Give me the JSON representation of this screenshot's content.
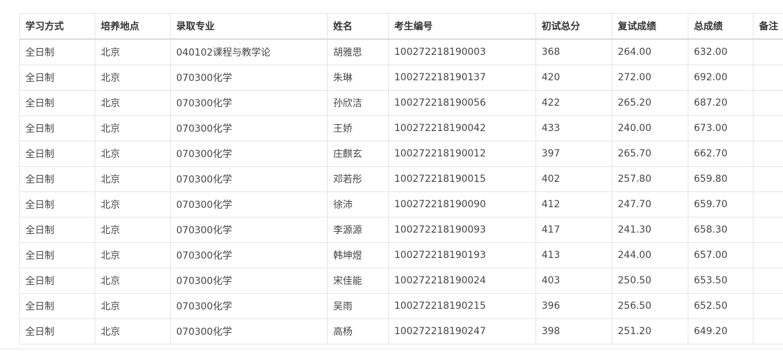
{
  "table": {
    "headers": [
      "学习方式",
      "培养地点",
      "录取专业",
      "姓名",
      "考生编号",
      "初试总分",
      "复试成绩",
      "总成绩",
      "备注"
    ],
    "rows": [
      [
        "全日制",
        "北京",
        "040102课程与教学论",
        "胡雅思",
        "100272218190003",
        "368",
        "264.00",
        "632.00",
        ""
      ],
      [
        "全日制",
        "北京",
        "070300化学",
        "朱琳",
        "100272218190137",
        "420",
        "272.00",
        "692.00",
        ""
      ],
      [
        "全日制",
        "北京",
        "070300化学",
        "孙欣洁",
        "100272218190056",
        "422",
        "265.20",
        "687.20",
        ""
      ],
      [
        "全日制",
        "北京",
        "070300化学",
        "王娇",
        "100272218190042",
        "433",
        "240.00",
        "673.00",
        ""
      ],
      [
        "全日制",
        "北京",
        "070300化学",
        "庄麒玄",
        "100272218190012",
        "397",
        "265.70",
        "662.70",
        ""
      ],
      [
        "全日制",
        "北京",
        "070300化学",
        "邓若彤",
        "100272218190015",
        "402",
        "257.80",
        "659.80",
        ""
      ],
      [
        "全日制",
        "北京",
        "070300化学",
        "徐沛",
        "100272218190090",
        "412",
        "247.70",
        "659.70",
        ""
      ],
      [
        "全日制",
        "北京",
        "070300化学",
        "李源源",
        "100272218190093",
        "417",
        "241.30",
        "658.30",
        ""
      ],
      [
        "全日制",
        "北京",
        "070300化学",
        "韩坤煜",
        "100272218190193",
        "413",
        "244.00",
        "657.00",
        ""
      ],
      [
        "全日制",
        "北京",
        "070300化学",
        "宋佳能",
        "100272218190024",
        "403",
        "250.50",
        "653.50",
        ""
      ],
      [
        "全日制",
        "北京",
        "070300化学",
        "吴雨",
        "100272218190215",
        "396",
        "256.50",
        "652.50",
        ""
      ],
      [
        "全日制",
        "北京",
        "070300化学",
        "高杨",
        "100272218190247",
        "398",
        "251.20",
        "649.20",
        ""
      ]
    ]
  }
}
